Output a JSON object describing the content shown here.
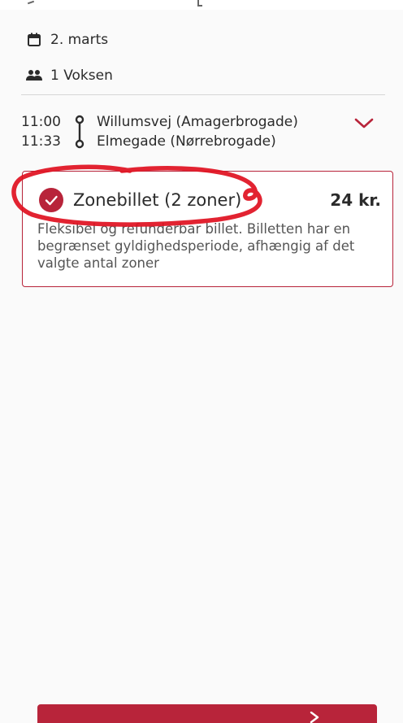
{
  "journey": {
    "date": "2. marts",
    "passengers": "1 Voksen",
    "departure_time": "11:00",
    "arrival_time": "11:33",
    "from_stop": "Willumsvej (Amagerbrogade)",
    "to_stop": "Elmegade (Nørrebrogade)"
  },
  "ticket": {
    "name": "Zonebillet (2 zoner)",
    "price": "24 kr.",
    "description": "Fleksibel og refunderbar billet. Billetten har en begrænset gyldighedsperiode, afhængig af det valgte antal zoner",
    "selected": true
  },
  "bottom_button": {
    "label": ""
  },
  "colors": {
    "accent": "#b8243a",
    "annotation_ink": "#e0101f",
    "text": "#2b2b2b",
    "muted_text": "#555555",
    "background": "#fafafa"
  },
  "icons": {
    "date": "calendar-icon",
    "passengers": "people-icon",
    "route": "route-line-icon",
    "expand": "chevron-down-icon",
    "selected": "check-circle-icon",
    "next": "arrow-right-icon"
  }
}
